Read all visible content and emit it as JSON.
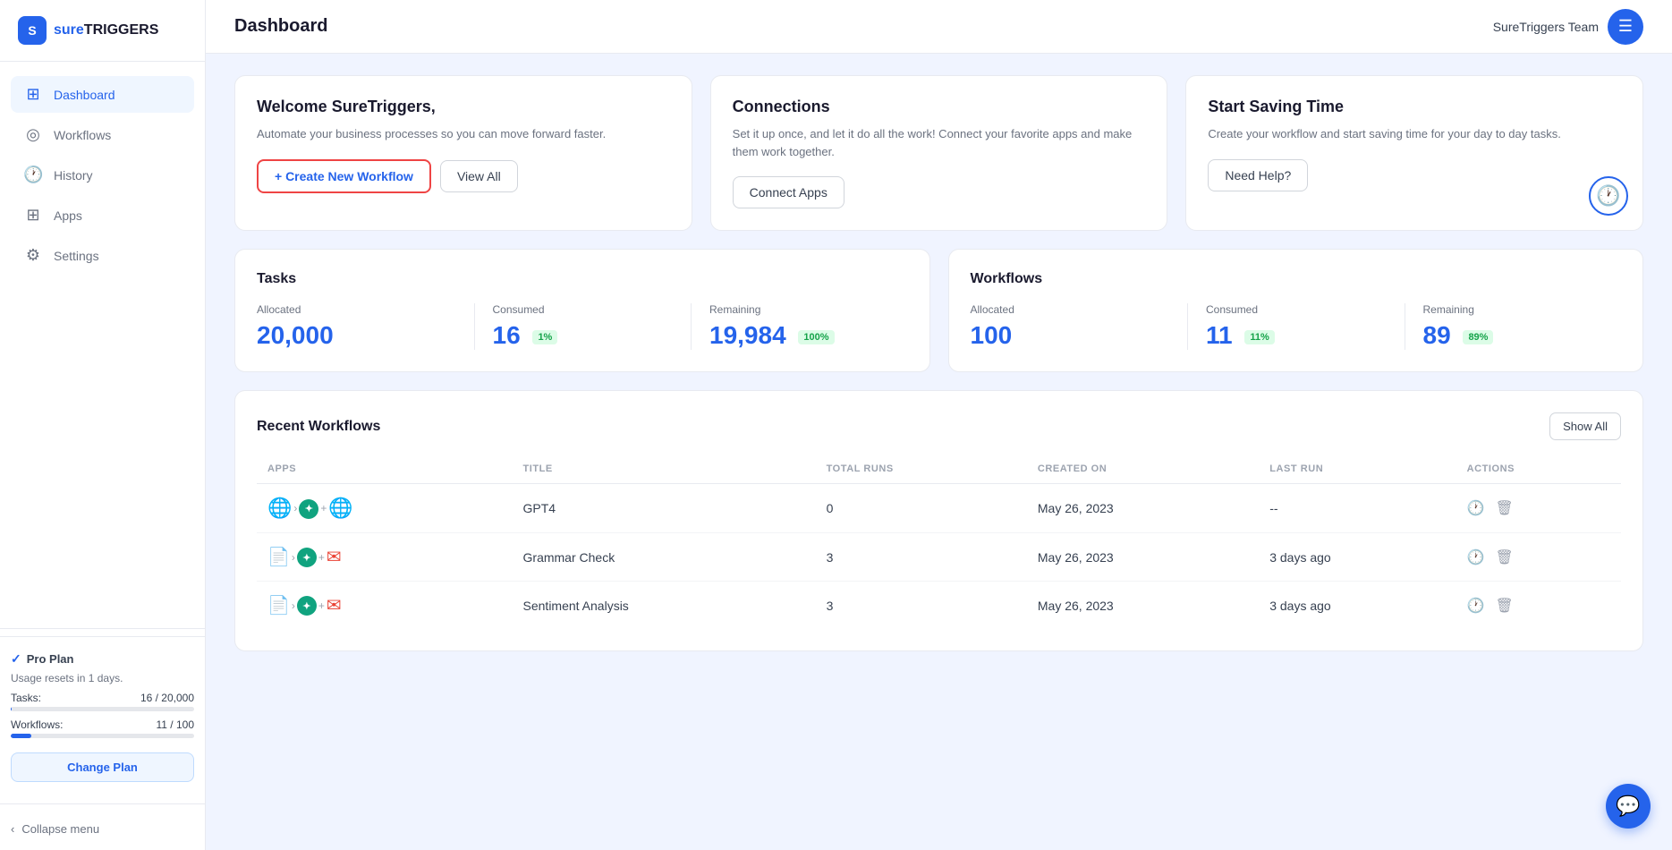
{
  "sidebar": {
    "logo_text_sure": "sure",
    "logo_text_triggers": "TRIGGERS",
    "nav_items": [
      {
        "id": "dashboard",
        "label": "Dashboard",
        "icon": "⊞",
        "active": true
      },
      {
        "id": "workflows",
        "label": "Workflows",
        "icon": "◎"
      },
      {
        "id": "history",
        "label": "History",
        "icon": "🕐"
      },
      {
        "id": "apps",
        "label": "Apps",
        "icon": "⊞"
      },
      {
        "id": "settings",
        "label": "Settings",
        "icon": "⚙"
      }
    ],
    "plan_label": "Pro Plan",
    "usage_reset": "Usage resets in 1 days.",
    "tasks_label": "Tasks:",
    "tasks_value": "16 / 20,000",
    "workflows_label": "Workflows:",
    "workflows_value": "11 / 100",
    "tasks_progress": 0.08,
    "workflows_progress": 11,
    "change_plan_label": "Change Plan",
    "collapse_label": "Collapse menu"
  },
  "header": {
    "title": "Dashboard",
    "team_name": "SureTriggers Team"
  },
  "welcome_card": {
    "title": "Welcome SureTriggers,",
    "description": "Automate your business processes so you can move forward faster.",
    "create_btn": "+ Create New Workflow",
    "view_all_btn": "View All"
  },
  "connections_card": {
    "title": "Connections",
    "description": "Set it up once, and let it do all the work! Connect your favorite apps and make them work together.",
    "connect_btn": "Connect Apps"
  },
  "saving_card": {
    "title": "Start Saving Time",
    "description": "Create your workflow and start saving time for your day to day tasks.",
    "help_btn": "Need Help?"
  },
  "tasks_stats": {
    "title": "Tasks",
    "allocated_label": "Allocated",
    "allocated_value": "20,000",
    "consumed_label": "Consumed",
    "consumed_value": "16",
    "consumed_badge": "1%",
    "remaining_label": "Remaining",
    "remaining_value": "19,984",
    "remaining_badge": "100%"
  },
  "workflows_stats": {
    "title": "Workflows",
    "allocated_label": "Allocated",
    "allocated_value": "100",
    "consumed_label": "Consumed",
    "consumed_value": "11",
    "consumed_badge": "11%",
    "remaining_label": "Remaining",
    "remaining_value": "89",
    "remaining_badge": "89%"
  },
  "recent_workflows": {
    "section_title": "Recent Workflows",
    "show_all_btn": "Show All",
    "columns": [
      "APPS",
      "TITLE",
      "TOTAL RUNS",
      "CREATED ON",
      "LAST RUN",
      "ACTIONS"
    ],
    "rows": [
      {
        "title": "GPT4",
        "apps": "wp-gpt-wp",
        "total_runs": "0",
        "created_on": "May 26, 2023",
        "last_run": "--"
      },
      {
        "title": "Grammar Check",
        "apps": "doc-gpt-gmail",
        "total_runs": "3",
        "created_on": "May 26, 2023",
        "last_run": "3 days ago"
      },
      {
        "title": "Sentiment Analysis",
        "apps": "doc-gpt-gmail",
        "total_runs": "3",
        "created_on": "May 26, 2023",
        "last_run": "3 days ago"
      }
    ]
  }
}
